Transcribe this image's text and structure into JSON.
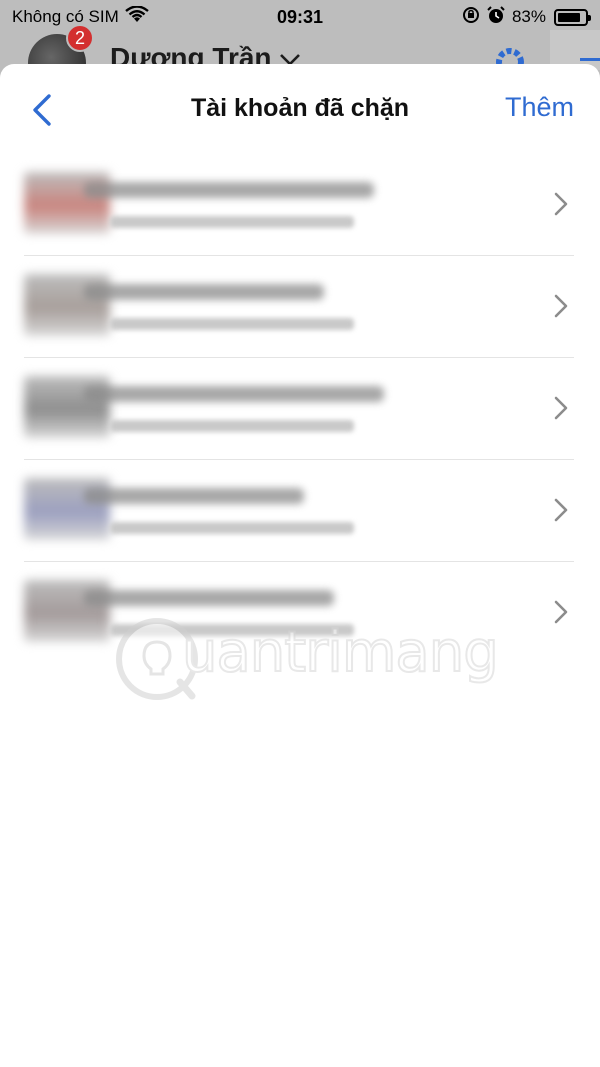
{
  "status_bar": {
    "carrier": "Không có SIM",
    "time": "09:31",
    "battery": "83%",
    "battery_level": 0.83
  },
  "behind": {
    "badge_count": "2",
    "profile_name": "Dương Trần"
  },
  "sheet": {
    "title": "Tài khoản đã chặn",
    "add_label": "Thêm"
  },
  "blocked_accounts": [
    {
      "avatar_color": "#c9847e",
      "name_width": 290
    },
    {
      "avatar_color": "#a79e9a",
      "name_width": 240
    },
    {
      "avatar_color": "#8d8d8d",
      "name_width": 300
    },
    {
      "avatar_color": "#9b9fbf",
      "name_width": 220
    },
    {
      "avatar_color": "#a39a9a",
      "name_width": 250
    }
  ],
  "watermark": {
    "text": "uantrimang"
  },
  "colors": {
    "accent": "#2f6bd1",
    "badge": "#d32f2f"
  },
  "icons": [
    "wifi-icon",
    "rotation-lock-icon",
    "alarm-icon",
    "battery-icon",
    "back-chevron-icon",
    "chevron-right-icon",
    "settings-gear-icon"
  ]
}
